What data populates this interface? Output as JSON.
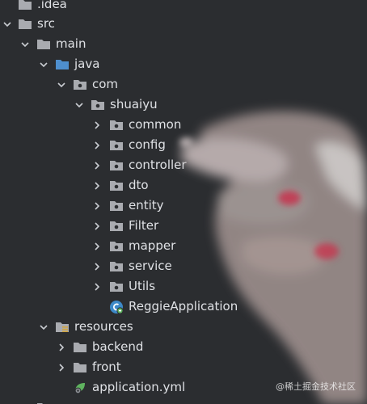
{
  "colors": {
    "background": "#2b2d30",
    "text": "#dfe1e5",
    "folder_gray": "#a9abb0",
    "folder_blue": "#4e8fce",
    "java_class": "#3d89c8",
    "spring_green": "#5fb35f",
    "resources_bars": "#d2a53c"
  },
  "tree": {
    "idea": {
      "label": ".idea",
      "icon": "folder-icon"
    },
    "src": {
      "label": "src",
      "icon": "folder-icon"
    },
    "main": {
      "label": "main",
      "icon": "folder-icon"
    },
    "java": {
      "label": "java",
      "icon": "source-root-folder-icon"
    },
    "com": {
      "label": "com",
      "icon": "package-icon"
    },
    "shuaiyu": {
      "label": "shuaiyu",
      "icon": "package-icon"
    },
    "packages": [
      {
        "label": "common",
        "icon": "package-icon"
      },
      {
        "label": "config",
        "icon": "package-icon"
      },
      {
        "label": "controller",
        "icon": "package-icon"
      },
      {
        "label": "dto",
        "icon": "package-icon"
      },
      {
        "label": "entity",
        "icon": "package-icon"
      },
      {
        "label": "Filter",
        "icon": "package-icon"
      },
      {
        "label": "mapper",
        "icon": "package-icon"
      },
      {
        "label": "service",
        "icon": "package-icon"
      },
      {
        "label": "Utils",
        "icon": "package-icon"
      }
    ],
    "app_class": {
      "label": "ReggieApplication",
      "icon": "spring-boot-class-icon"
    },
    "resources": {
      "label": "resources",
      "icon": "resources-folder-icon"
    },
    "backend": {
      "label": "backend",
      "icon": "folder-icon"
    },
    "front": {
      "label": "front",
      "icon": "folder-icon"
    },
    "app_yml": {
      "label": "application.yml",
      "icon": "spring-config-icon"
    }
  },
  "watermark": "@稀土掘金技术社区"
}
